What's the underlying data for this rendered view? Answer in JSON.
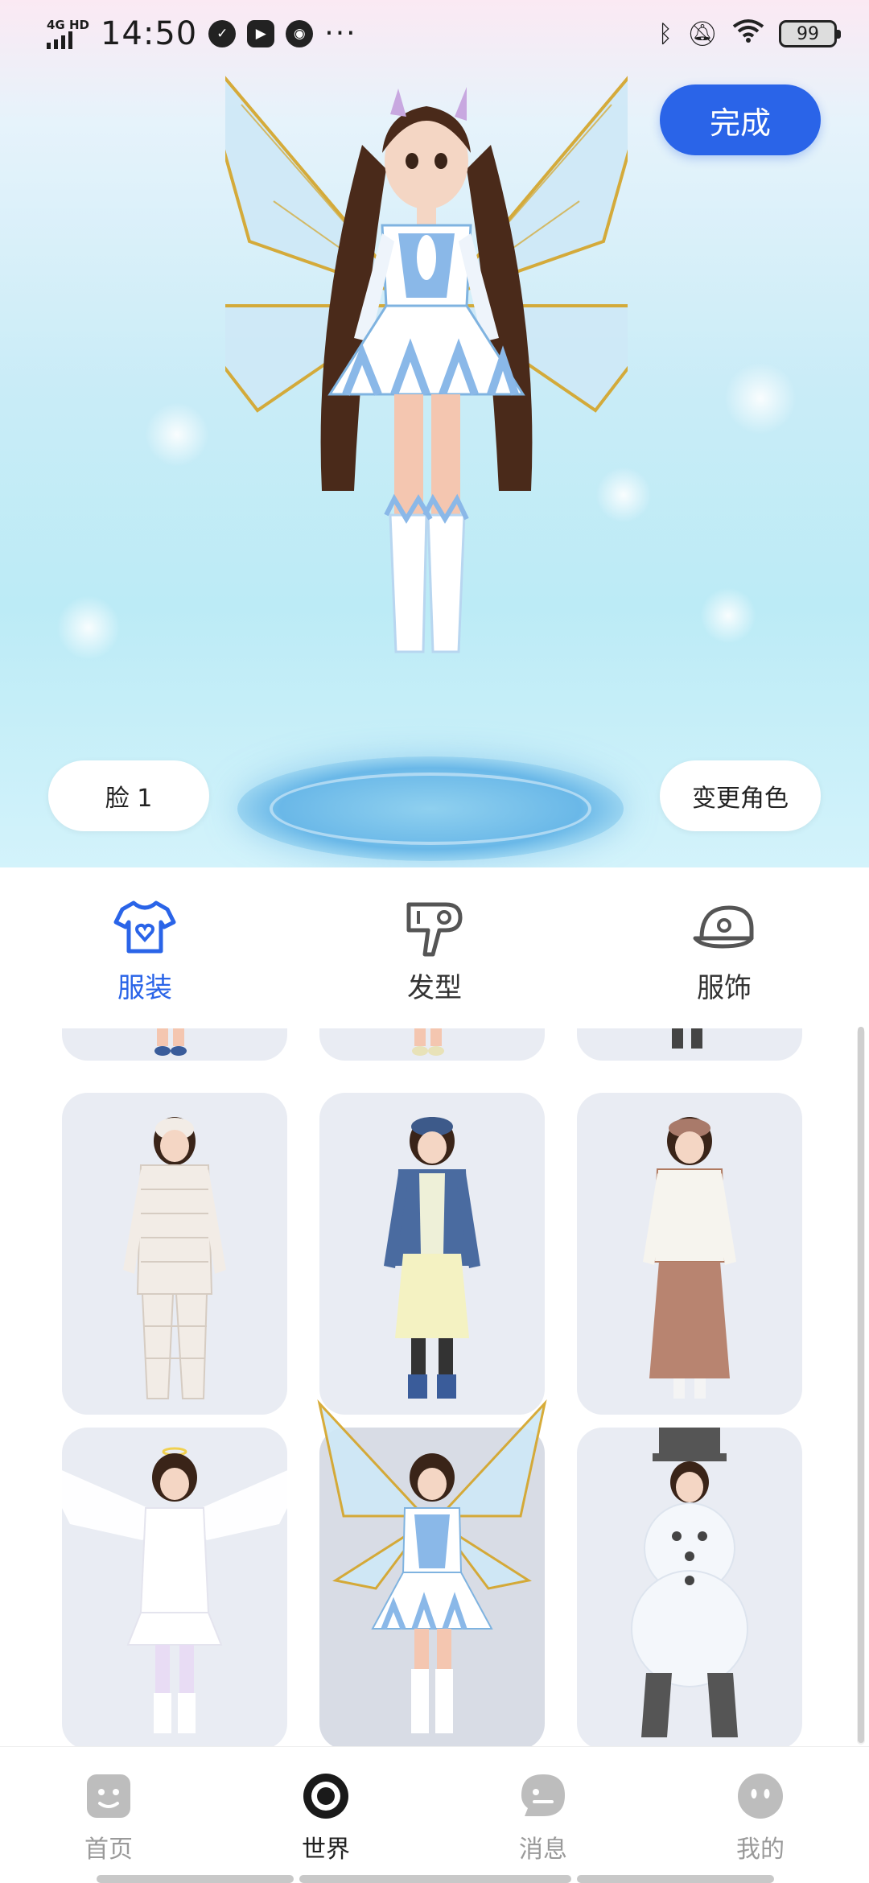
{
  "status_bar": {
    "network": "4G HD",
    "time": "14:50",
    "battery": "99",
    "left_icons": [
      "signal-icon",
      "check-app-icon",
      "video-app-icon",
      "wechat-icon",
      "more-dots-icon"
    ],
    "right_icons": [
      "bluetooth-icon",
      "mute-icon",
      "wifi-icon",
      "battery-icon"
    ]
  },
  "preview": {
    "done_label": "完成",
    "face_label": "脸 1",
    "change_role_label": "变更角色"
  },
  "categories": [
    {
      "label": "服装",
      "icon": "shirt-icon",
      "active": true
    },
    {
      "label": "发型",
      "icon": "hair-dryer-icon",
      "active": false
    },
    {
      "label": "服饰",
      "icon": "cap-icon",
      "active": false
    }
  ],
  "outfits": [
    {
      "name": "partial-outfit-1",
      "icon": "outfit-partial-icon"
    },
    {
      "name": "partial-outfit-2",
      "icon": "outfit-partial-icon"
    },
    {
      "name": "partial-outfit-3",
      "icon": "outfit-partial-icon"
    },
    {
      "name": "mummy-outfit",
      "icon": "mummy-costume-icon"
    },
    {
      "name": "denim-jacket-outfit",
      "icon": "denim-jacket-icon"
    },
    {
      "name": "brown-skirt-outfit",
      "icon": "brown-skirt-icon"
    },
    {
      "name": "angel-outfit",
      "icon": "angel-wings-icon"
    },
    {
      "name": "fairy-outfit",
      "icon": "fairy-wings-icon",
      "selected": true
    },
    {
      "name": "snowman-outfit",
      "icon": "snowman-icon"
    }
  ],
  "bottom_nav": [
    {
      "label": "首页",
      "icon": "home-face-icon",
      "active": false
    },
    {
      "label": "世界",
      "icon": "world-ring-icon",
      "active": true
    },
    {
      "label": "消息",
      "icon": "message-bubble-icon",
      "active": false
    },
    {
      "label": "我的",
      "icon": "profile-face-icon",
      "active": false
    }
  ],
  "colors": {
    "accent": "#2a64e8",
    "card_bg": "#e9ecf3",
    "nav_inactive": "#9a9a9a"
  }
}
